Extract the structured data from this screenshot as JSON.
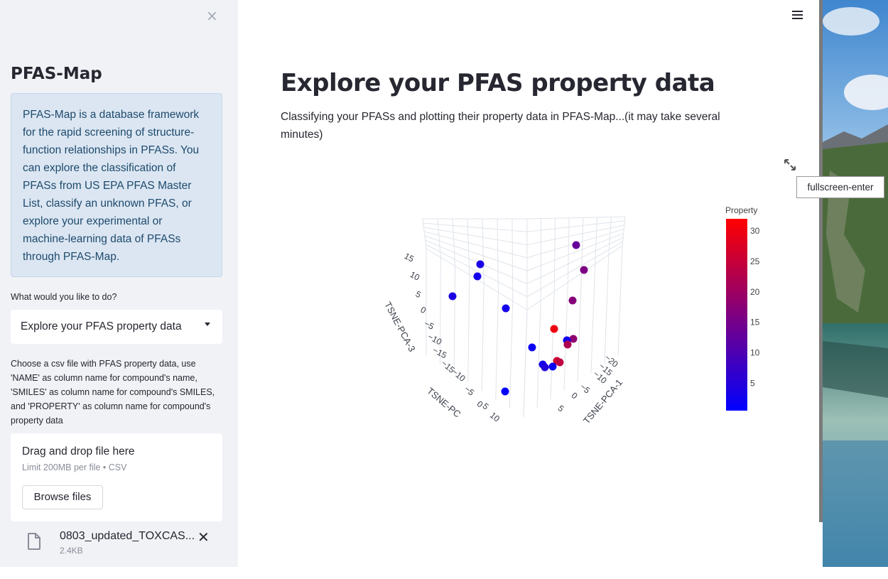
{
  "sidebar": {
    "close_glyph": "×",
    "title": "PFAS-Map",
    "info": "PFAS-Map is a database framework for the rapid screening of structure-function relationships in PFASs. You can explore the classification of PFASs from US EPA PFAS Master List, classify an unknown PFAS, or explore your experimental or machine-learning data of PFASs through PFAS-Map.",
    "question_label": "What would you like to do?",
    "select_value": "Explore your PFAS property data",
    "upload_help": "Choose a csv file with PFAS property data, use 'NAME' as column name for compound's name, 'SMILES' as column name for compound's SMILES, and 'PROPERTY' as column name for compound's property data",
    "dropzone_title": "Drag and drop file here",
    "dropzone_limit": "Limit 200MB per file • CSV",
    "browse_label": "Browse files",
    "file_name": "0803_updated_TOXCAS...",
    "file_size": "2.4KB"
  },
  "main": {
    "title": "Explore your PFAS property data",
    "description": "Classifying your PFASs and plotting their property data in PFAS-Map...(it may take several minutes)",
    "tooltip": "fullscreen-enter"
  },
  "chart_data": {
    "type": "scatter",
    "axis_titles": [
      "TSNE-PCA-1",
      "TSNE-PC",
      "TSNE-PCA-3"
    ],
    "axis1_ticks": [
      "−20",
      "−15",
      "−10",
      "−5",
      "0",
      "5"
    ],
    "axis2_ticks": [
      "−15",
      "−10",
      "−5",
      "0",
      "5",
      "10"
    ],
    "axis3_ticks": [
      "15",
      "10",
      "5",
      "0",
      "−5",
      "−10",
      "−15"
    ],
    "colorbar_title": "Property",
    "colorbar_ticks": [
      30,
      25,
      20,
      15,
      10,
      5
    ],
    "colorbar_range": [
      0.5,
      32
    ],
    "colorscale": [
      "#0000ff",
      "#ff0000"
    ],
    "points_property": [
      13,
      4,
      16,
      3,
      4,
      3,
      17,
      30,
      18,
      2,
      3,
      22,
      26,
      24,
      3,
      5,
      2,
      1
    ]
  }
}
